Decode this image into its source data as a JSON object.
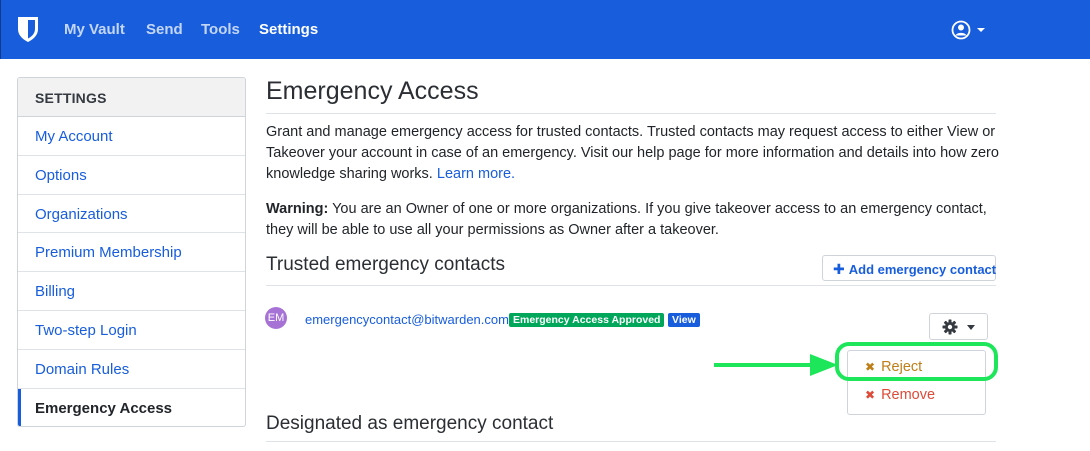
{
  "navbar": {
    "links": [
      "My Vault",
      "Send",
      "Tools",
      "Settings"
    ],
    "active": "Settings",
    "brand_color": "#175ddc"
  },
  "sidebar": {
    "header": "SETTINGS",
    "items": [
      {
        "label": "My Account"
      },
      {
        "label": "Options"
      },
      {
        "label": "Organizations"
      },
      {
        "label": "Premium Membership"
      },
      {
        "label": "Billing"
      },
      {
        "label": "Two-step Login"
      },
      {
        "label": "Domain Rules"
      },
      {
        "label": "Emergency Access"
      }
    ],
    "active": "Emergency Access"
  },
  "main": {
    "title": "Emergency Access",
    "intro": "Grant and manage emergency access for trusted contacts. Trusted contacts may request access to either View or Takeover your account in case of an emergency. Visit our help page for more information and details into how zero knowledge sharing works.",
    "learn_more": "Learn more.",
    "warning_label": "Warning:",
    "warning_text": "You are an Owner of one or more organizations. If you give takeover access to an emergency contact, they will be able to use all your permissions as Owner after a takeover.",
    "trusted_title": "Trusted emergency contacts",
    "add_button": "Add emergency contact",
    "designated_title": "Designated as emergency contact",
    "contact": {
      "initials": "EM",
      "email": "emergencycontact@bitwarden.com",
      "status_badge": "Emergency Access Approved",
      "type_badge": "View",
      "menu": {
        "reject": "Reject",
        "remove": "Remove"
      }
    }
  },
  "colors": {
    "approved": "#00a65a",
    "reject": "#bf7e16",
    "remove": "#dd4b39",
    "highlight": "#1ee65a"
  }
}
